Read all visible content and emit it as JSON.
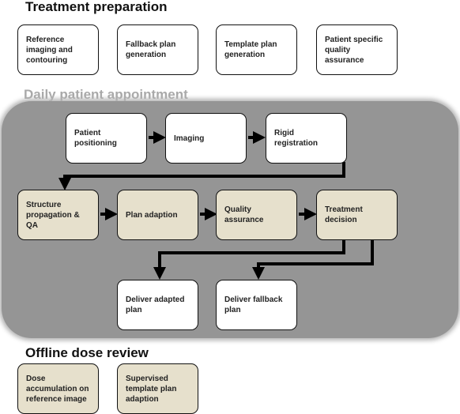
{
  "sections": {
    "preparation": {
      "title": "Treatment preparation",
      "steps": [
        "Reference imaging and contouring",
        "Fallback plan generation",
        "Template plan generation",
        "Patient specific quality assurance"
      ]
    },
    "daily": {
      "title": "Daily patient appointment",
      "setup_steps": [
        "Patient positioning",
        "Imaging",
        "Rigid registration"
      ],
      "adaptive_steps": [
        "Structure propagation & QA",
        "Plan adaption",
        "Quality assurance",
        "Treatment decision"
      ],
      "delivery_steps": [
        "Deliver adapted plan",
        "Deliver fallback plan"
      ]
    },
    "offline": {
      "title": "Offline dose review",
      "steps": [
        "Dose accumulation on reference image",
        "Supervised template plan adaption"
      ]
    }
  },
  "colors": {
    "panel": "#959595",
    "adaptive_fill": "#e6e0cc",
    "section_title_daily": "#a9a9a9"
  }
}
